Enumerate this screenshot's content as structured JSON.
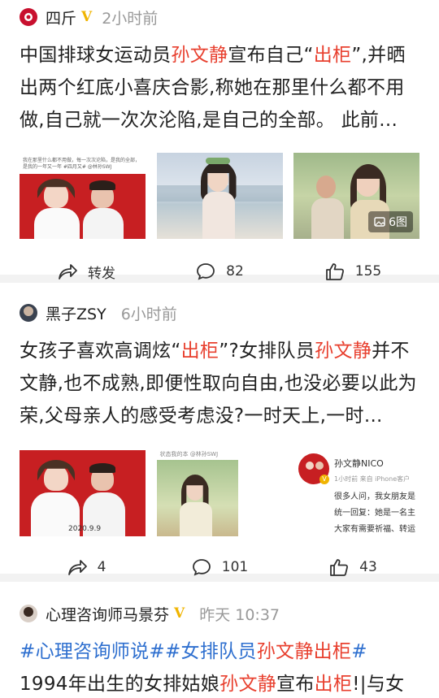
{
  "posts": [
    {
      "author": "四斤",
      "verified": "V",
      "time": "2小时前",
      "text_parts": [
        "中国排球女运动员",
        "孙文静",
        "宣布自己“",
        "出柜",
        "”,并晒出两个红底小喜庆合影,称她在那里什么都不用做,自己就一次次沦陷,是自己的全部。 此前..."
      ],
      "image_caption_1": "我在那里什么都不用做，每一次次沦陷，是我的全部，是我的一年又一年 #四月又# @林孙SWJ",
      "images_count": "6图",
      "repost_label": "转发",
      "comments": "82",
      "likes": "155"
    },
    {
      "author": "黑子ZSY",
      "time": "6小时前",
      "text_parts": [
        "女孩子喜欢高调炫“",
        "出柜",
        "”?女排队员",
        "孙文静",
        "并不文静,也不成熟,即便性取向自由,也没必要以此为荣,父母亲人的感受考虑没?一时天上,一时..."
      ],
      "image_date": "2020.9.9",
      "image_caption_2": "状态我的本 @林孙SWJ",
      "card_name": "孙文静NICO",
      "card_meta": "1小时前  来自 iPhone客户",
      "card_lines": [
        "很多人问，我女朋友是",
        "统一回复：她是一名主",
        "大家有需要祈福、转运"
      ],
      "reposts": "4",
      "comments": "101",
      "likes": "43"
    },
    {
      "author": "心理咨询师马景芬",
      "verified": "V",
      "time": "昨天 10:37",
      "tag1": "#心理咨询师说#",
      "tag2_a": "#女排队员",
      "tag2_b": "孙文静出柜",
      "tag2_c": "#",
      "text_rest_1": " 1994年出生的女排姑娘",
      "name_hl": "孙文静",
      "text_rest_2": "宣布",
      "hl2": "出柜",
      "text_rest_3": "!|与女朋友交"
    }
  ],
  "colors": {
    "highlight": "#e8402f",
    "topic": "#2e6fcf",
    "verified": "#f0b400",
    "meta": "#999999"
  },
  "icons": [
    "repost-icon",
    "comment-icon",
    "like-icon",
    "image-icon"
  ]
}
